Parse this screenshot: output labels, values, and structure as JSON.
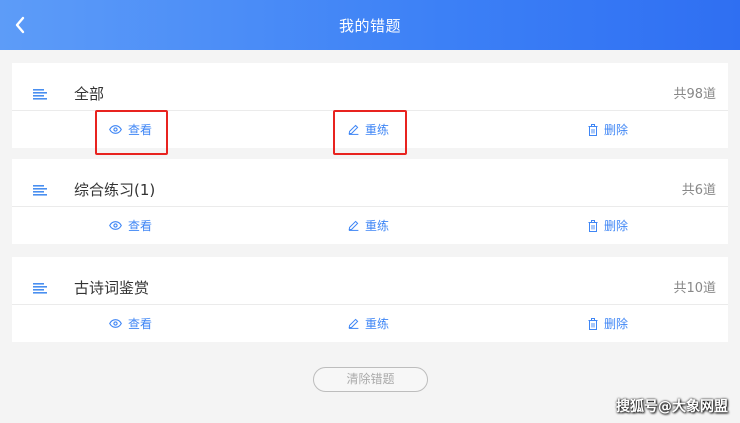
{
  "header": {
    "title": "我的错题"
  },
  "categories": [
    {
      "name": "全部",
      "count": "共98道",
      "actions": {
        "view": "查看",
        "redo": "重练",
        "delete": "删除"
      }
    },
    {
      "name": "综合练习(1)",
      "count": "共6道",
      "actions": {
        "view": "查看",
        "redo": "重练",
        "delete": "删除"
      }
    },
    {
      "name": "古诗词鉴赏",
      "count": "共10道",
      "actions": {
        "view": "查看",
        "redo": "重练",
        "delete": "删除"
      }
    }
  ],
  "footer": {
    "clear_label": "清除错题"
  },
  "watermark": "搜狐号@大象网盟",
  "colors": {
    "accent": "#3f86f5",
    "header": "#3c80f6",
    "highlight": "#e8231f"
  }
}
